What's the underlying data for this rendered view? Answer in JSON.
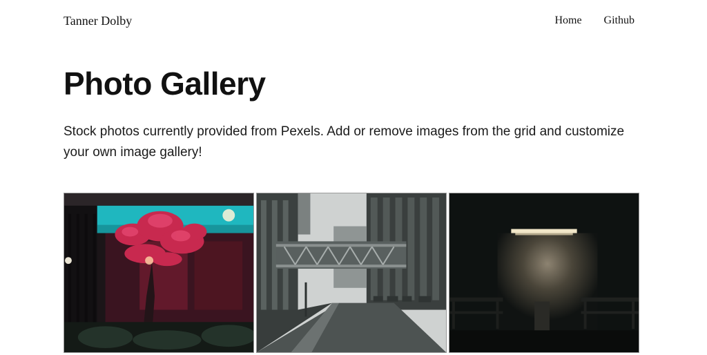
{
  "header": {
    "brand": "Tanner Dolby",
    "nav": [
      {
        "label": "Home"
      },
      {
        "label": "Github"
      }
    ]
  },
  "main": {
    "title": "Photo Gallery",
    "description": "Stock photos currently provided from Pexels. Add or remove images from the grid and customize your own image gallery!"
  },
  "gallery": {
    "images": [
      {
        "subject": "red leafed tree beside neon-lit storefront at night"
      },
      {
        "subject": "city street with skybridge between tall buildings on a rainy day"
      },
      {
        "subject": "dim lamp over wall with two benches at night"
      }
    ]
  }
}
